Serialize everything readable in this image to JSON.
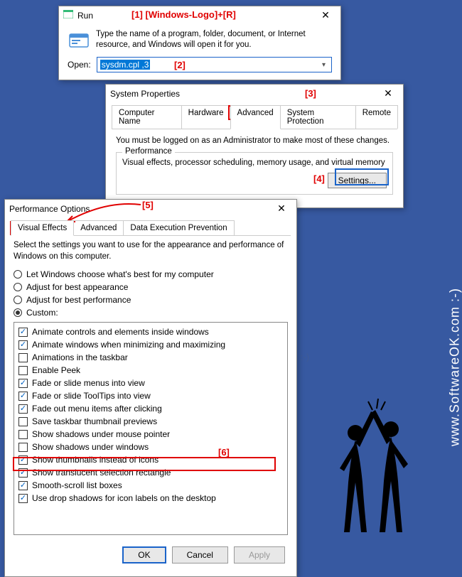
{
  "annotations": {
    "a1": "[1]   [Windows-Logo]+[R]",
    "a2": "[2]",
    "a3": "[3]",
    "a4": "[4]",
    "a5": "[5]",
    "a6": "[6]"
  },
  "watermark": "www.SoftwareOK.com :-)",
  "run": {
    "title": "Run",
    "description": "Type the name of a program, folder, document, or Internet resource, and Windows will open it for you.",
    "open_label": "Open:",
    "input_value": "sysdm.cpl ,3"
  },
  "sysprops": {
    "title": "System Properties",
    "tabs": [
      "Computer Name",
      "Hardware",
      "Advanced",
      "System Protection",
      "Remote"
    ],
    "active_tab": 2,
    "admin_note": "You must be logged on as an Administrator to make most of these changes.",
    "perf_group": "Performance",
    "perf_desc": "Visual effects, processor scheduling, memory usage, and virtual memory",
    "settings_btn": "Settings..."
  },
  "perf": {
    "title": "Performance Options",
    "tabs": [
      "Visual Effects",
      "Advanced",
      "Data Execution Prevention"
    ],
    "active_tab": 0,
    "desc": "Select the settings you want to use for the appearance and performance of Windows on this computer.",
    "radios": [
      {
        "label": "Let Windows choose what's best for my computer",
        "selected": false
      },
      {
        "label": "Adjust for best appearance",
        "selected": false
      },
      {
        "label": "Adjust for best performance",
        "selected": false
      },
      {
        "label": "Custom:",
        "selected": true
      }
    ],
    "checks": [
      {
        "label": "Animate controls and elements inside windows",
        "checked": true
      },
      {
        "label": "Animate windows when minimizing and maximizing",
        "checked": true
      },
      {
        "label": "Animations in the taskbar",
        "checked": false
      },
      {
        "label": "Enable Peek",
        "checked": false
      },
      {
        "label": "Fade or slide menus into view",
        "checked": true
      },
      {
        "label": "Fade or slide ToolTips into view",
        "checked": true
      },
      {
        "label": "Fade out menu items after clicking",
        "checked": true
      },
      {
        "label": "Save taskbar thumbnail previews",
        "checked": false
      },
      {
        "label": "Show shadows under mouse pointer",
        "checked": false
      },
      {
        "label": "Show shadows under windows",
        "checked": false
      },
      {
        "label": "Show thumbnails instead of icons",
        "checked": true
      },
      {
        "label": "Show translucent selection rectangle",
        "checked": true
      },
      {
        "label": "Smooth-scroll list boxes",
        "checked": true
      },
      {
        "label": "Use drop shadows for icon labels on the desktop",
        "checked": true
      }
    ],
    "buttons": {
      "ok": "OK",
      "cancel": "Cancel",
      "apply": "Apply"
    }
  }
}
